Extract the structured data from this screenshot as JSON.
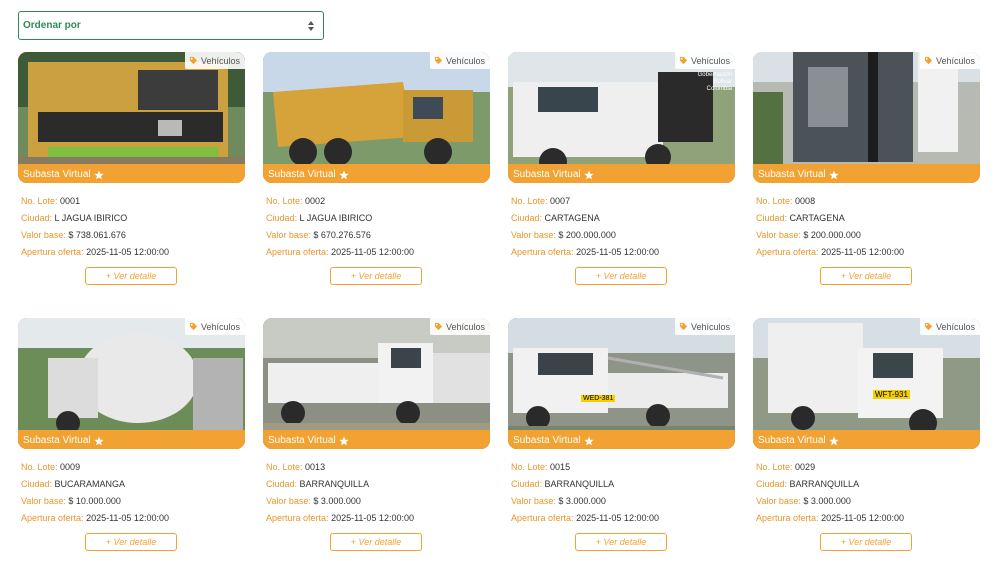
{
  "sort": {
    "label": "Ordenar por"
  },
  "category_label": "Vehículos",
  "ribbon_label": "Subasta Virtual",
  "field_labels": {
    "lote": "No. Lote:",
    "ciudad": "Ciudad:",
    "valor": "Valor base:",
    "apertura": "Apertura oferta:"
  },
  "detail_label": "+ Ver detalle",
  "colors": {
    "accent": "#f2a232",
    "sort_green": "#2e8b57"
  },
  "lots": [
    {
      "lote": "0001",
      "ciudad": "L JAGUA IBIRICO",
      "valor": "$ 738.061.676",
      "apertura": "2025-11-05 12:00:00",
      "image": "yellow-mining-dump-truck",
      "overlay_text": ""
    },
    {
      "lote": "0002",
      "ciudad": "L JAGUA IBIRICO",
      "valor": "$ 670.276.576",
      "apertura": "2025-11-05 12:00:00",
      "image": "yellow-dump-truck",
      "overlay_text": ""
    },
    {
      "lote": "0007",
      "ciudad": "CARTAGENA",
      "valor": "$ 200.000.000",
      "apertura": "2025-11-05 12:00:00",
      "image": "white-vacuum-truck",
      "overlay_text": "Gobernación Bolívar Colombia"
    },
    {
      "lote": "0008",
      "ciudad": "CARTAGENA",
      "valor": "$ 200.000.000",
      "apertura": "2025-11-05 12:00:00",
      "image": "truck-equipment-rear",
      "overlay_text": ""
    },
    {
      "lote": "0009",
      "ciudad": "BUCARAMANGA",
      "valor": "$ 10.000.000",
      "apertura": "2025-11-05 12:00:00",
      "image": "white-sewer-truck",
      "overlay_text": ""
    },
    {
      "lote": "0013",
      "ciudad": "BARRANQUILLA",
      "valor": "$ 3.000.000",
      "apertura": "2025-11-05 12:00:00",
      "image": "white-pickup-truck",
      "overlay_text": ""
    },
    {
      "lote": "0015",
      "ciudad": "BARRANQUILLA",
      "valor": "$ 3.000.000",
      "apertura": "2025-11-05 12:00:00",
      "image": "white-pickup-rack",
      "overlay_text": "WED-381"
    },
    {
      "lote": "0029",
      "ciudad": "BARRANQUILLA",
      "valor": "$ 3.000.000",
      "apertura": "2025-11-05 12:00:00",
      "image": "white-box-truck",
      "overlay_text": "WFT-931"
    }
  ]
}
